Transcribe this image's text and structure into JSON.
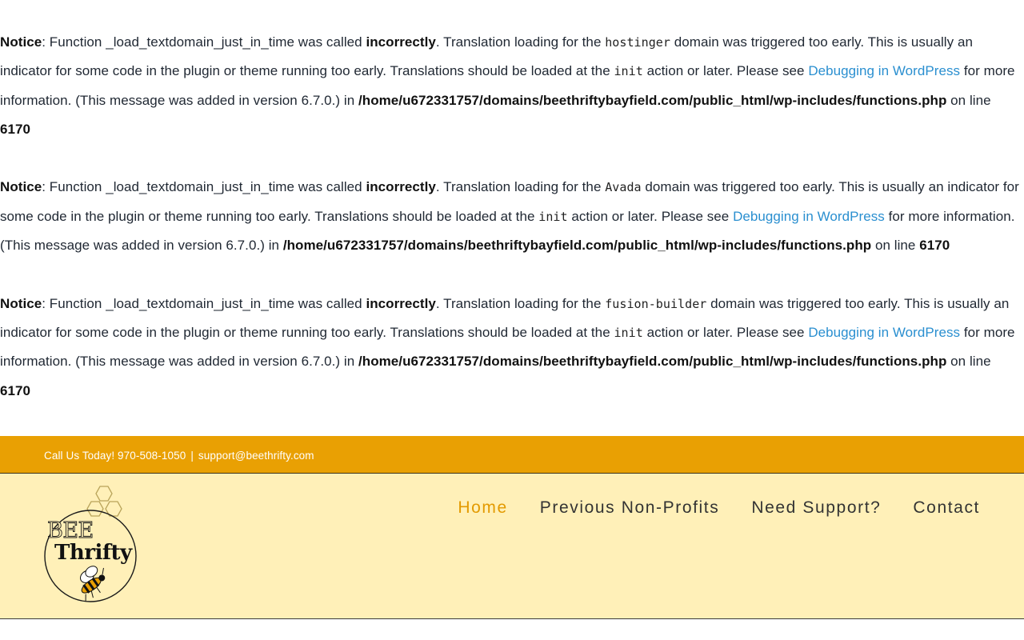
{
  "notices": [
    {
      "label": "Notice",
      "text1": ": Function _load_textdomain_just_in_time was called ",
      "bold1": "incorrectly",
      "text2": ". Translation loading for the ",
      "domain": "hostinger",
      "text3": " domain was triggered too early. This is usually an indicator for some code in the plugin or theme running too early. Translations should be loaded at the ",
      "action": "init",
      "text4": " action or later. Please see ",
      "link": "Debugging in WordPress",
      "text5": " for more information. (This message was added in version 6.7.0.) in ",
      "path": "/home/u672331757/domains/beethriftybayfield.com/public_html/wp-includes/functions.php",
      "text6": " on line ",
      "line": "6170"
    },
    {
      "label": "Notice",
      "text1": ": Function _load_textdomain_just_in_time was called ",
      "bold1": "incorrectly",
      "text2": ". Translation loading for the ",
      "domain": "Avada",
      "text3": " domain was triggered too early. This is usually an indicator for some code in the plugin or theme running too early. Translations should be loaded at the ",
      "action": "init",
      "text4": " action or later. Please see ",
      "link": "Debugging in WordPress",
      "text5": " for more information. (This message was added in version 6.7.0.) in ",
      "path": "/home/u672331757/domains/beethriftybayfield.com/public_html/wp-includes/functions.php",
      "text6": " on line ",
      "line": "6170"
    },
    {
      "label": "Notice",
      "text1": ": Function _load_textdomain_just_in_time was called ",
      "bold1": "incorrectly",
      "text2": ". Translation loading for the ",
      "domain": "fusion-builder",
      "text3": " domain was triggered too early. This is usually an indicator for some code in the plugin or theme running too early. Translations should be loaded at the ",
      "action": "init",
      "text4": " action or later. Please see ",
      "link": "Debugging in WordPress",
      "text5": " for more information. (This message was added in version 6.7.0.) in ",
      "path": "/home/u672331757/domains/beethriftybayfield.com/public_html/wp-includes/functions.php",
      "text6": " on line ",
      "line": "6170"
    }
  ],
  "topbar": {
    "phone": "Call Us Today! 970-508-1050",
    "separator": "|",
    "email": "support@beethrifty.com",
    "color": "#e9a003"
  },
  "header": {
    "background": "#fff0b8",
    "logo": {
      "line1": "BEE",
      "line2": "Thrifty"
    },
    "nav": [
      {
        "label": "Home",
        "active": true
      },
      {
        "label": "Previous Non-Profits",
        "active": false
      },
      {
        "label": "Need Support?",
        "active": false
      },
      {
        "label": "Contact",
        "active": false
      }
    ]
  }
}
